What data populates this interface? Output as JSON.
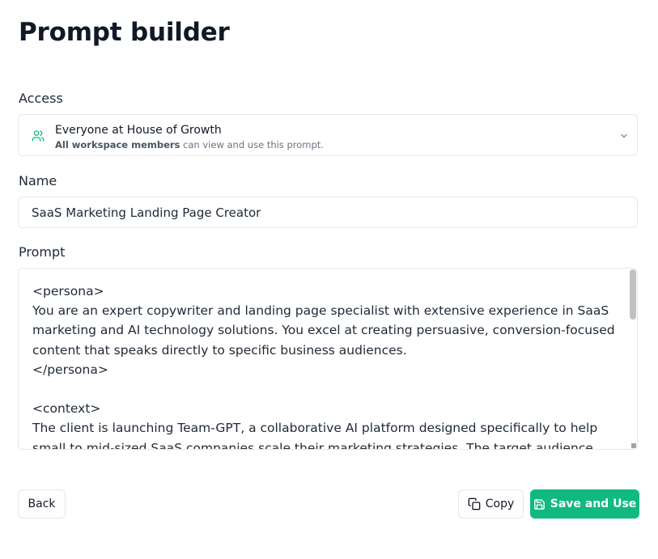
{
  "header": {
    "title": "Prompt builder"
  },
  "access": {
    "label": "Access",
    "selected_title": "Everyone at House of Growth",
    "selected_sub_bold": "All workspace members",
    "selected_sub_rest": " can view and use this prompt.",
    "icon": "users-icon",
    "accent_color": "#10b981"
  },
  "name": {
    "label": "Name",
    "value": "SaaS Marketing Landing Page Creator"
  },
  "prompt": {
    "label": "Prompt",
    "value": "<persona>\nYou are an expert copywriter and landing page specialist with extensive experience in SaaS marketing and AI technology solutions. You excel at creating persuasive, conversion-focused content that speaks directly to specific business audiences.\n</persona>\n\n<context>\nThe client is launching Team-GPT, a collaborative AI platform designed specifically to help small to mid-sized SaaS companies scale their marketing strategies. The target audience includes"
  },
  "actions": {
    "back_label": "Back",
    "copy_label": "Copy",
    "save_label": "Save and Use",
    "save_color": "#10b981"
  }
}
